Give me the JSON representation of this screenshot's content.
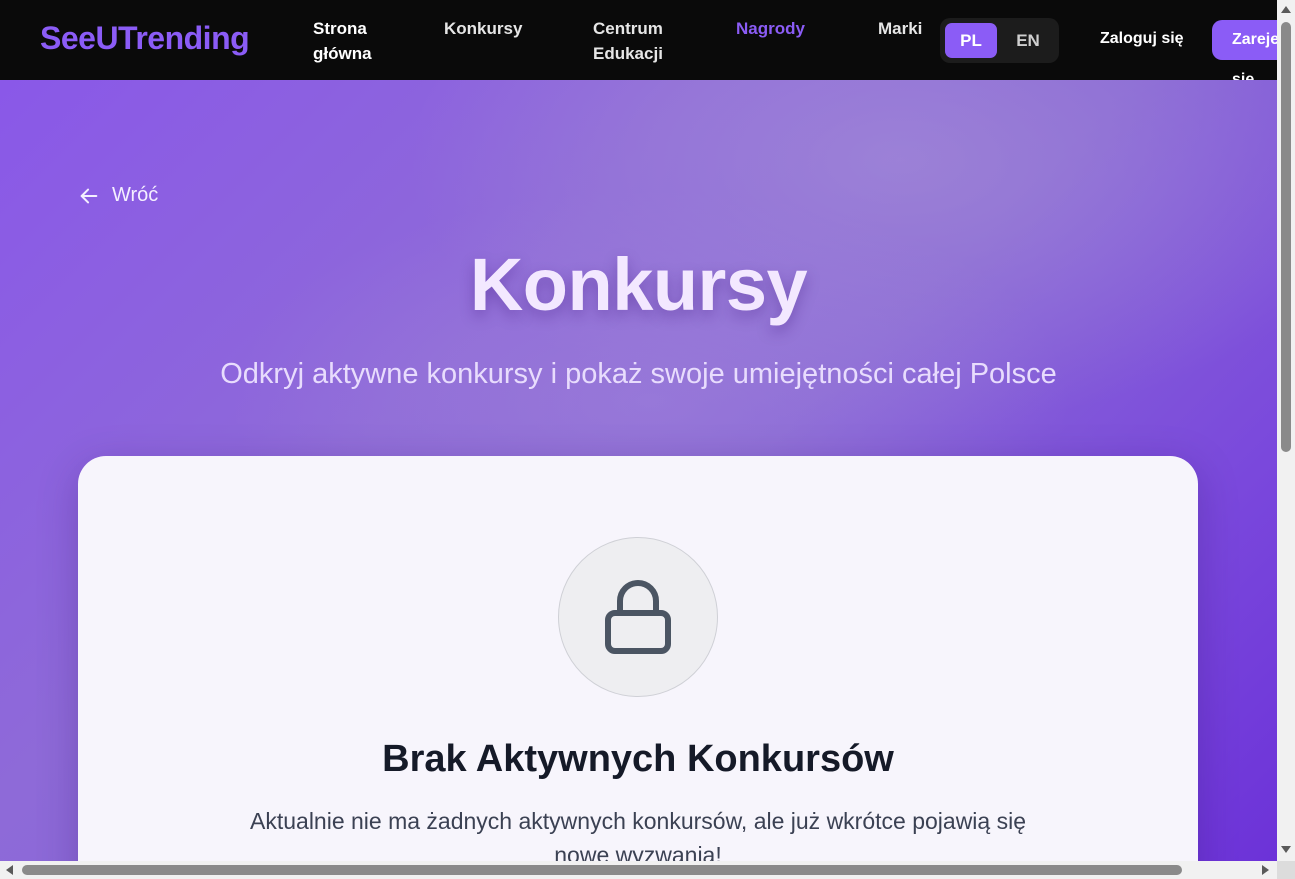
{
  "navbar": {
    "brand": "SeeUTrending",
    "links": [
      {
        "line1": "Strona",
        "line2": "główna"
      },
      {
        "line1": "Konkursy",
        "line2": ""
      },
      {
        "line1": "Centrum",
        "line2": "Edukacji"
      },
      {
        "line1": "Nagrody",
        "line2": ""
      },
      {
        "line1": "Marki",
        "line2": ""
      }
    ],
    "active_link": "Nagrody",
    "languages": [
      "PL",
      "EN"
    ],
    "selected_language": "PL",
    "login_label": "Zaloguj się",
    "register_label": "Zarejestruj się"
  },
  "hero": {
    "back_label": "Wróć",
    "title": "Konkursy",
    "subtitle": "Odkryj aktywne konkursy i pokaż swoje umiejętności całej Polsce"
  },
  "empty_state": {
    "icon": "lock-icon",
    "title": "Brak Aktywnych Konkursów",
    "text": "Aktualnie nie ma żadnych aktywnych konkursów, ale już wkrótce pojawią się nowe wyzwania!"
  },
  "colors": {
    "accent": "#8b5cf6",
    "navbar_bg": "#0a0a0a",
    "hero_gradient_start": "#8a58e8",
    "hero_gradient_end": "#6c32d8"
  }
}
